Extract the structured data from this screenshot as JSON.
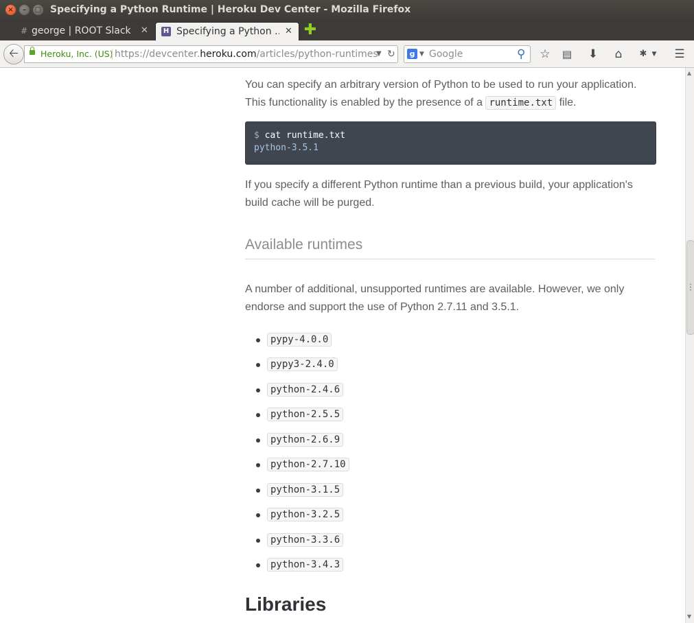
{
  "window": {
    "title": "Specifying a Python Runtime | Heroku Dev Center - Mozilla Firefox"
  },
  "tabs": [
    {
      "label": "george | ROOT Slack",
      "favicon": "#"
    },
    {
      "label": "Specifying a Python …",
      "favicon": "H"
    }
  ],
  "navbar": {
    "identity": "Heroku, Inc. (US)",
    "url_prefix": "https://devcenter.",
    "url_host": "heroku.com",
    "url_path": "/articles/python-runtimes",
    "search_placeholder": "Google"
  },
  "content": {
    "intro_line1": "You can specify an arbitrary version of Python to be used to run your application.",
    "intro_line2_before": "This functionality is enabled by the presence of a ",
    "intro_code": "runtime.txt",
    "intro_line2_after": " file.",
    "code_prompt": "$ ",
    "code_command": "cat runtime.txt",
    "code_output": "python-3.5.1",
    "purge_line1": "If you specify a different Python runtime than a previous build, your application's",
    "purge_line2": "build cache will be purged.",
    "section_heading": "Available runtimes",
    "avail_line1": "A number of additional, unsupported runtimes are available. However, we only",
    "avail_line2": "endorse and support the use of Python 2.7.11 and 3.5.1.",
    "runtimes": [
      "pypy-4.0.0",
      "pypy3-2.4.0",
      "python-2.4.6",
      "python-2.5.5",
      "python-2.6.9",
      "python-2.7.10",
      "python-3.1.5",
      "python-3.2.5",
      "python-3.3.6",
      "python-3.4.3"
    ],
    "next_heading": "Libraries"
  }
}
